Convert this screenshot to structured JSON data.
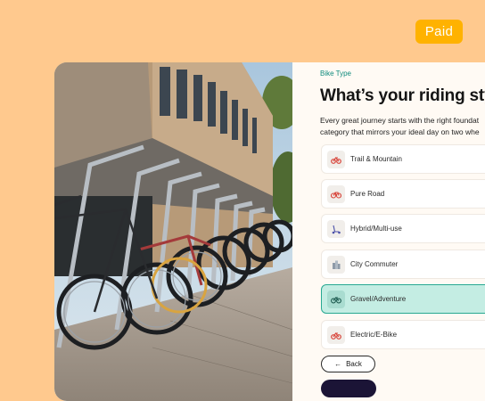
{
  "badge": {
    "label": "Paid",
    "color": "#ffb200"
  },
  "form": {
    "step_label": "Bike Type",
    "heading": "What’s your riding styl",
    "subtitle_line1": "Every great journey starts with the right foundat",
    "subtitle_line2": "category that mirrors your ideal day on two whe",
    "options": [
      {
        "label": "Trail & Mountain",
        "icon": "mountain-bike-icon",
        "selected": false
      },
      {
        "label": "Pure Road",
        "icon": "road-bike-icon",
        "selected": false
      },
      {
        "label": "Hybrid/Multi-use",
        "icon": "scooter-icon",
        "selected": false
      },
      {
        "label": "City Commuter",
        "icon": "city-building-icon",
        "selected": false
      },
      {
        "label": "Gravel/Adventure",
        "icon": "gravel-bike-icon",
        "selected": true
      },
      {
        "label": "Electric/E-Bike",
        "icon": "e-bike-icon",
        "selected": false
      }
    ],
    "back_label": "Back",
    "accent_color": "#28a992",
    "icon_color": "#d8443a"
  }
}
